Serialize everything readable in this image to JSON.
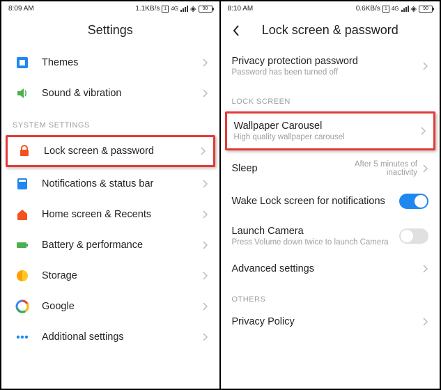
{
  "left": {
    "status": {
      "time": "8:09 AM",
      "net": "1.1KB/s",
      "tag": "4G",
      "battery": "90"
    },
    "title": "Settings",
    "items": [
      {
        "icon": "themes",
        "label": "Themes"
      },
      {
        "icon": "sound",
        "label": "Sound & vibration"
      }
    ],
    "section1_header": "SYSTEM SETTINGS",
    "highlighted": {
      "icon": "lock",
      "label": "Lock screen & password"
    },
    "items2": [
      {
        "icon": "notify",
        "label": "Notifications & status bar"
      },
      {
        "icon": "home",
        "label": "Home screen & Recents"
      },
      {
        "icon": "battery",
        "label": "Battery & performance"
      },
      {
        "icon": "storage",
        "label": "Storage"
      },
      {
        "icon": "google",
        "label": "Google"
      },
      {
        "icon": "more",
        "label": "Additional settings"
      }
    ]
  },
  "right": {
    "status": {
      "time": "8:10 AM",
      "net": "0.6KB/s",
      "tag": "4G",
      "battery": "90"
    },
    "title": "Lock screen & password",
    "privacy": {
      "label": "Privacy protection password",
      "sub": "Password has been turned off"
    },
    "section1_header": "LOCK SCREEN",
    "highlighted": {
      "label": "Wallpaper Carousel",
      "sub": "High quality wallpaper carousel"
    },
    "items": [
      {
        "label": "Sleep",
        "value": "After 5 minutes of inactivity"
      },
      {
        "label": "Wake Lock screen for notifications",
        "toggle": "on"
      },
      {
        "label": "Launch Camera",
        "sub": "Press Volume down twice to launch Camera",
        "toggle": "off"
      },
      {
        "label": "Advanced settings",
        "chev": true
      }
    ],
    "section2_header": "OTHERS",
    "items2": [
      {
        "label": "Privacy Policy",
        "chev": true
      }
    ]
  }
}
